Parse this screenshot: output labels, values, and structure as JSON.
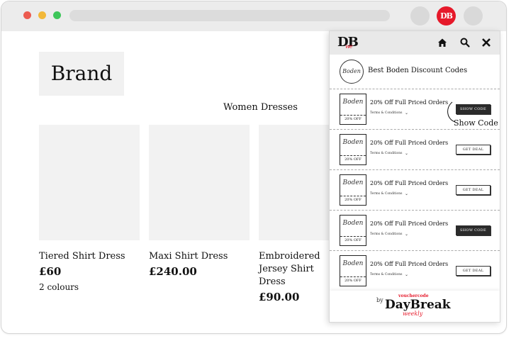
{
  "browser": {
    "extension_icon_text": "DB"
  },
  "page": {
    "brand": "Brand",
    "section_title": "Women Dresses",
    "products": [
      {
        "name": "Tiered Shirt Dress",
        "price": "£60",
        "meta": "2 colours"
      },
      {
        "name": "Maxi Shirt Dress",
        "price": "£240.00",
        "meta": ""
      },
      {
        "name": "Embroidered Jersey Shirt Dress",
        "price": "£90.00",
        "meta": ""
      }
    ]
  },
  "panel": {
    "logo": "DB",
    "logo_sub": "we",
    "store_logo": "Boden",
    "store_title": "Best Boden Discount Codes",
    "callout": "Show Code",
    "offers": [
      {
        "thumb": "Boden",
        "discount": "20% OFF",
        "title": "20% Off Full Priced Orders",
        "terms": "Terms & Conditions",
        "button": "SHOW CODE",
        "style": "dark"
      },
      {
        "thumb": "Boden",
        "discount": "20% OFF",
        "title": "20% Off Full Priced Orders",
        "terms": "Terms & Conditions",
        "button": "GET DEAL",
        "style": "light"
      },
      {
        "thumb": "Boden",
        "discount": "20% OFF",
        "title": "20% Off Full Priced Orders",
        "terms": "Terms & Conditions",
        "button": "GET DEAL",
        "style": "light"
      },
      {
        "thumb": "Boden",
        "discount": "20% OFF",
        "title": "20% Off Full Priced Orders",
        "terms": "Terms & Conditions",
        "button": "SHOW CODE",
        "style": "dark"
      },
      {
        "thumb": "Boden",
        "discount": "20% OFF",
        "title": "20% Off Full Priced Orders",
        "terms": "Terms & Conditions",
        "button": "GET DEAL",
        "style": "light"
      }
    ],
    "footer": {
      "by": "by",
      "vouchercode": "vouchercode",
      "name": "DayBreak",
      "weekly": "weekly"
    }
  },
  "colors": {
    "accent": "#e6192a",
    "dark_button": "#2b2b2b"
  }
}
